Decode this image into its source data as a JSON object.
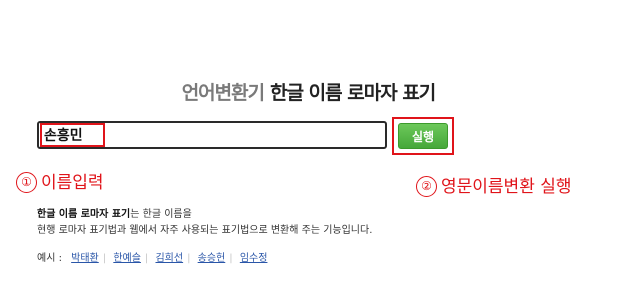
{
  "header": {
    "service_name": "언어변환기",
    "tool_name": "한글 이름 로마자 표기"
  },
  "search": {
    "value": "손흥민"
  },
  "run_button": {
    "label": "실행"
  },
  "annotations": {
    "step1_number": "①",
    "step1_text": "이름입력",
    "step2_number": "②",
    "step2_text": "영문이름변환 실행"
  },
  "description": {
    "bold": "한글 이름 로마자 표기",
    "line1_rest": "는 한글 이름을",
    "line2": "현행 로마자 표기법과 웹에서 자주 사용되는 표기법으로 변환해 주는 기능입니다."
  },
  "examples": {
    "label": "예시 :",
    "items": [
      "박태환",
      "한예슬",
      "김희선",
      "송승헌",
      "임수정"
    ]
  },
  "colors": {
    "annotation": "#e0141a",
    "button": "#4caf3e",
    "link": "#2a56a8"
  }
}
